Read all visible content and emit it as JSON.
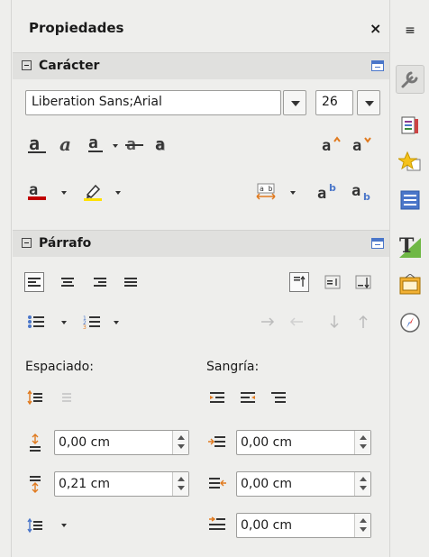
{
  "deck": {
    "title": "Propiedades",
    "close": "×",
    "menu_glyph": "≡"
  },
  "character": {
    "section_label": "Carácter",
    "font_name": "Liberation Sans;Arial",
    "font_size": "26"
  },
  "paragraph": {
    "section_label": "Párrafo",
    "spacing_label": "Espaciado:",
    "indent_label": "Sangría:",
    "above_spacing": "0,00 cm",
    "below_spacing": "0,21 cm",
    "before_indent": "0,00 cm",
    "after_indent": "0,00 cm",
    "first_line_indent": "0,00 cm"
  },
  "colors": {
    "accent_blue": "#4a76c9",
    "font_color_bar": "#c00000",
    "highlight_yellow": "#ffe100"
  },
  "sidebar_tabs": [
    "properties-icon",
    "styles-icon",
    "gallery-icon",
    "navigator-icon",
    "page-icon",
    "manage-changes-icon",
    "design-icon"
  ]
}
